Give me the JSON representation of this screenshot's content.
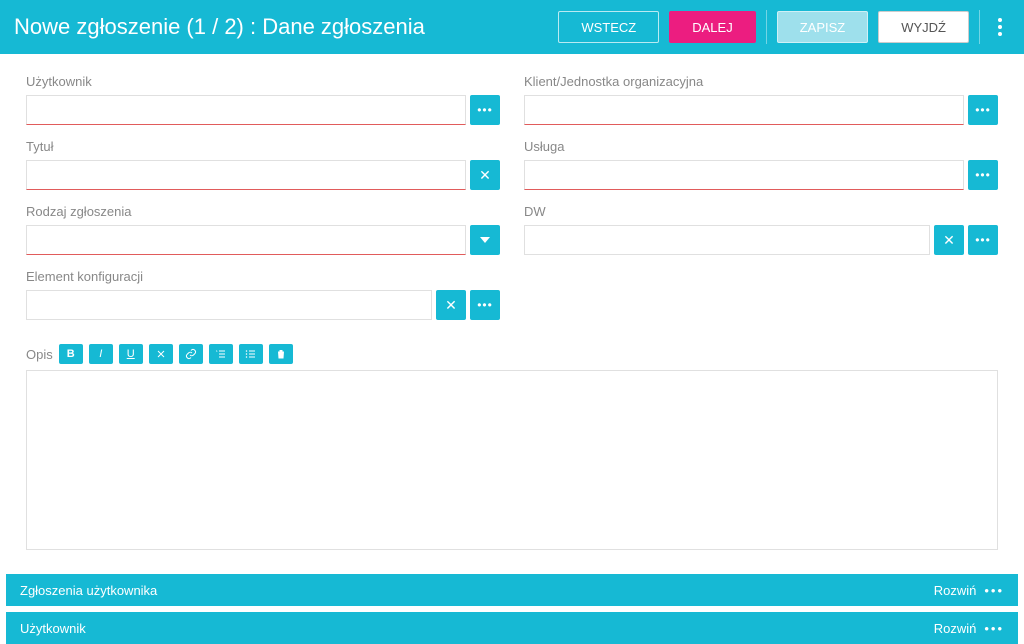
{
  "header": {
    "title": "Nowe zgłoszenie (1 / 2) : Dane zgłoszenia",
    "buttons": {
      "back": "WSTECZ",
      "next": "DALEJ",
      "save": "ZAPISZ",
      "exit": "WYJDŹ"
    }
  },
  "fields": {
    "user_label": "Użytkownik",
    "client_label": "Klient/Jednostka organizacyjna",
    "title_label": "Tytuł",
    "service_label": "Usługa",
    "type_label": "Rodzaj zgłoszenia",
    "cc_label": "DW",
    "ci_label": "Element konfiguracji",
    "desc_label": "Opis"
  },
  "toolbar": {
    "bold": "B",
    "italic": "I",
    "underline": "U"
  },
  "sections": {
    "user_tickets": "Zgłoszenia użytkownika",
    "user": "Użytkownik",
    "expand": "Rozwiń"
  }
}
